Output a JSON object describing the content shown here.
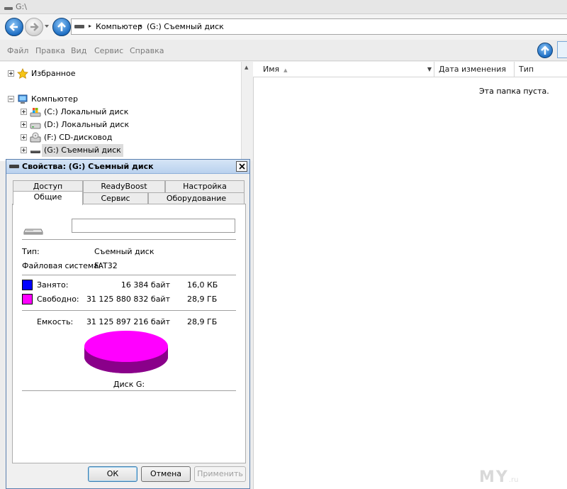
{
  "window": {
    "title": "G:\\"
  },
  "address": {
    "crumbs": [
      "Компьютер",
      "(G:) Съемный диск"
    ]
  },
  "menu": [
    "Файл",
    "Правка",
    "Вид",
    "Сервис",
    "Справка"
  ],
  "tree": {
    "favorites": "Избранное",
    "computer": "Компьютер",
    "drives": [
      {
        "label": "(C:) Локальный диск",
        "icon": "windows-drive-icon"
      },
      {
        "label": "(D:) Локальный диск",
        "icon": "hard-drive-icon"
      },
      {
        "label": "(F:) CD-дисковод",
        "icon": "cd-drive-icon"
      },
      {
        "label": "(G:) Съемный диск",
        "icon": "removable-drive-icon",
        "selected": true
      }
    ]
  },
  "columns": [
    "Имя",
    "Дата изменения",
    "Тип"
  ],
  "content": {
    "empty_message": "Эта папка пуста."
  },
  "dialog": {
    "title": "Свойства: (G:) Съемный диск",
    "tabs_top": [
      "Доступ",
      "ReadyBoost",
      "Настройка"
    ],
    "tabs_bottom": [
      "Общие",
      "Сервис",
      "Оборудование"
    ],
    "active_tab": "Общие",
    "volume_label": "",
    "type_label": "Тип:",
    "type_value": "Съемный диск",
    "fs_label": "Файловая система:",
    "fs_value": "FAT32",
    "used": {
      "label": "Занято:",
      "bytes": "16 384 байт",
      "size": "16,0 КБ",
      "color": "#0000ff"
    },
    "free": {
      "label": "Свободно:",
      "bytes": "31 125 880 832 байт",
      "size": "28,9 ГБ",
      "color": "#ff00ff"
    },
    "capacity": {
      "label": "Емкость:",
      "bytes": "31 125 897 216 байт",
      "size": "28,9 ГБ"
    },
    "disk_caption": "Диск G:",
    "buttons": {
      "ok": "ОК",
      "cancel": "Отмена",
      "apply": "Применить"
    }
  },
  "watermark": {
    "main": "MY",
    "suffix": ".ru"
  }
}
